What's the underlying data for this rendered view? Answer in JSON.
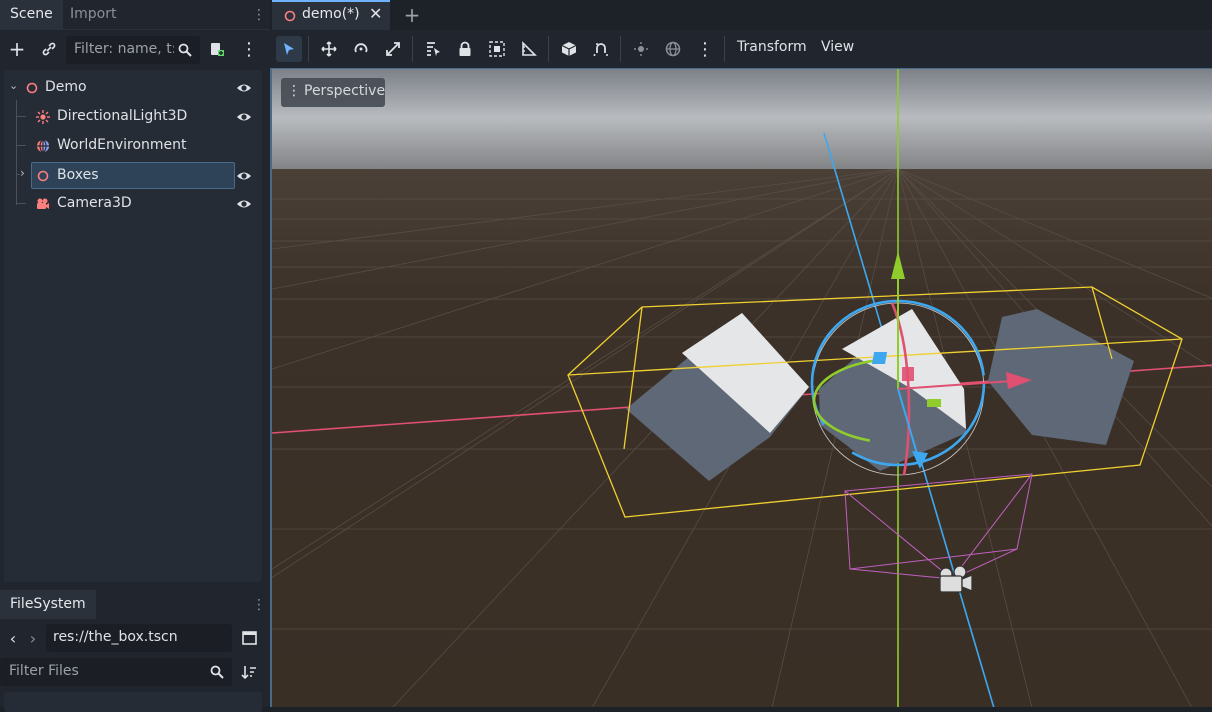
{
  "left_dock": {
    "tabs": [
      "Scene",
      "Import"
    ],
    "filter_placeholder": "Filter: name, t:t",
    "tree": [
      {
        "label": "Demo",
        "icon": "node3d-icon"
      },
      {
        "label": "DirectionalLight3D",
        "icon": "light-icon"
      },
      {
        "label": "WorldEnvironment",
        "icon": "world-env-icon"
      },
      {
        "label": "Boxes",
        "icon": "node3d-icon"
      },
      {
        "label": "Camera3D",
        "icon": "camera-icon"
      }
    ]
  },
  "filesystem": {
    "tab": "FileSystem",
    "path": "res://the_box.tscn",
    "filter_placeholder": "Filter Files"
  },
  "editor": {
    "scene_tab": "demo(*)",
    "menus": [
      "Transform",
      "View"
    ],
    "viewport_label": "Perspective"
  },
  "colors": {
    "bg": "#1d2229",
    "panel": "#21262e",
    "accent": "#6fb3ff",
    "selection": "#2e4358",
    "sky_top": "#7b8088",
    "ground": "#3b3128"
  }
}
